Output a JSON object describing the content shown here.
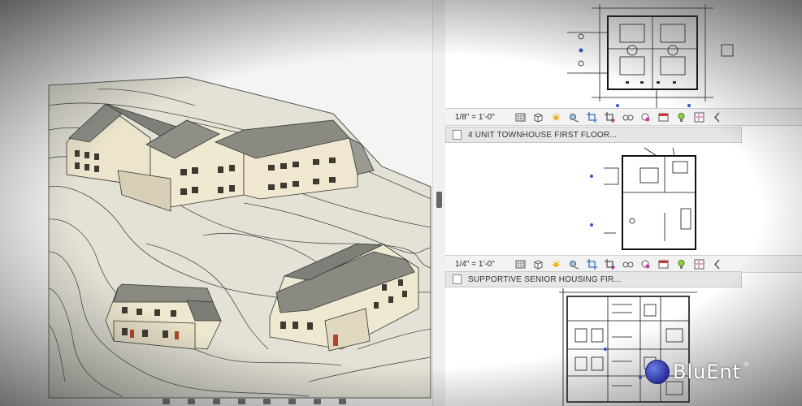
{
  "views": [
    {
      "scale": "1/8\" = 1'-0\"",
      "title": "4 UNIT TOWNHOUSE FIRST FLOOR..."
    },
    {
      "scale": "1/4\" = 1'-0\"",
      "title": "SUPPORTIVE SENIOR HOUSING FIR..."
    }
  ],
  "toolbar_icons": [
    "detail-level-icon",
    "visual-style-icon",
    "sun-path-icon",
    "shadows-icon",
    "crop-view-icon",
    "show-crop-icon",
    "temporary-hide-icon",
    "reveal-hidden-icon",
    "analytical-model-icon",
    "highlight-displacement-icon",
    "sun-settings-icon",
    "more-arrow-icon"
  ],
  "logo": {
    "text": "BluEnt",
    "registered": "®"
  },
  "colors": {
    "terrain": "#e3e1d4",
    "building_wall": "#efe8d0",
    "roof": "#8a8a82",
    "logo_globe": "#3a40b5"
  }
}
